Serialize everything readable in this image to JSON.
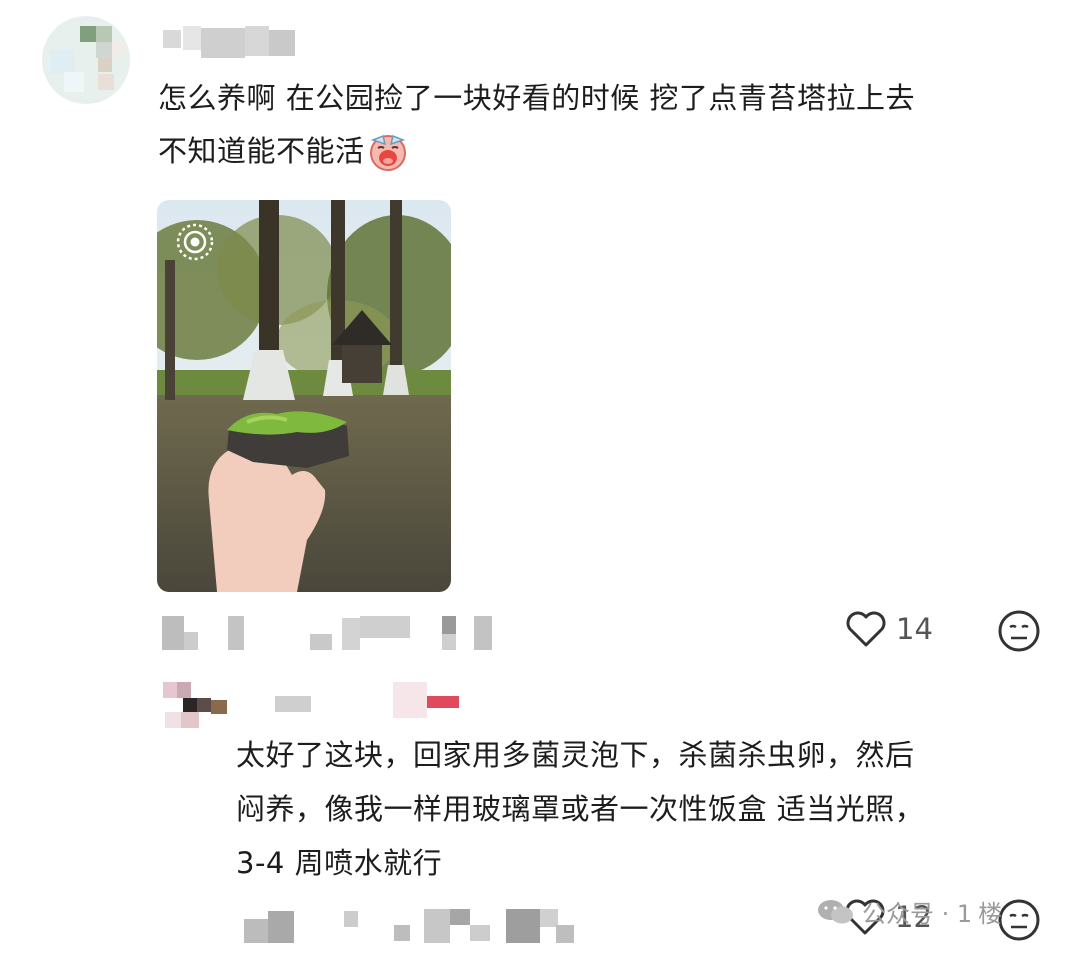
{
  "comment": {
    "text_line1": "怎么养啊 在公园捡了一块好看的时候 挖了点青苔塔拉上去",
    "text_line2": "不知道能不能活",
    "emoji": "crying-face-emoji",
    "likes": "14"
  },
  "reply": {
    "line1": "太好了这块，回家用多菌灵泡下，杀菌杀虫卵，然后",
    "line2": "闷养，像我一样用玻璃罩或者一次性饭盒 适当光照，",
    "line3": "3-4 周喷水就行",
    "likes": "12"
  },
  "watermark": {
    "text": "公众号 · 1",
    "suffix": "楼"
  },
  "colors": {
    "text": "#1d1d1d",
    "muted": "#555555",
    "icon": "#333333"
  }
}
